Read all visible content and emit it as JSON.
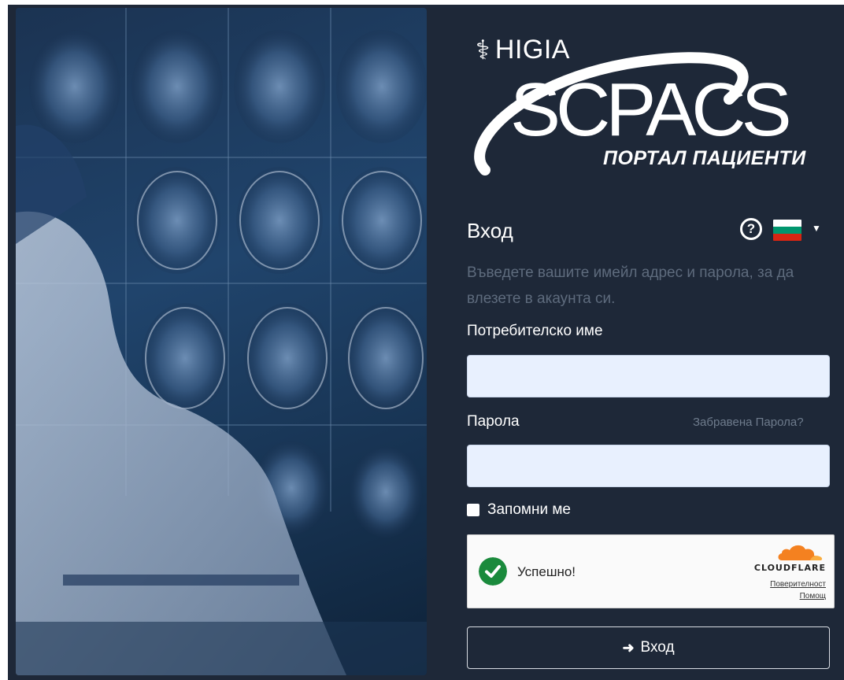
{
  "brand": {
    "higia": "HIGIA",
    "product": "SCPACS",
    "subtitle": "ПОРТАЛ ПАЦИЕНТИ"
  },
  "login": {
    "title": "Вход",
    "description": "Въведете вашите имейл адрес и парола, за да влезете в акаунта си.",
    "username_label": "Потребителско име",
    "username_value": "",
    "password_label": "Парола",
    "password_value": "",
    "forgot_password": "Забравена Парола?",
    "remember_me": "Запомни ме",
    "submit": "Вход"
  },
  "captcha": {
    "status": "Успешно!",
    "brand": "CLOUDFLARE",
    "privacy": "Поверителност",
    "help": "Помощ"
  },
  "icons": {
    "help": "help-circle-icon",
    "language": "bulgarian-flag-icon",
    "login": "sign-in-icon",
    "captcha_success": "check-circle-icon"
  },
  "colors": {
    "background": "#1e2838",
    "input_fill": "#e8f0fe",
    "muted_text": "#5e6b7d",
    "success": "#1a8a3c",
    "cloudflare_orange": "#f48120"
  }
}
